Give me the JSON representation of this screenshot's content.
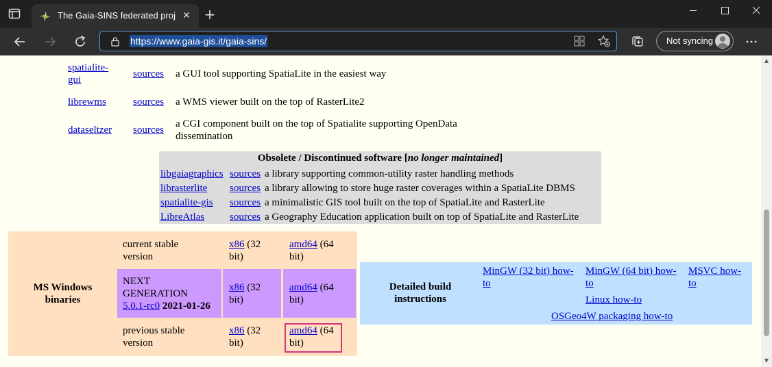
{
  "browser": {
    "tab_title": "The Gaia-SINS federated project",
    "url": "https://www.gaia-gis.it/gaia-sins/",
    "profile_label": "Not syncing",
    "icons": [
      "tab-actions-icon",
      "favicon-icon",
      "close-icon",
      "plus-icon",
      "minimize-icon",
      "maximize-icon",
      "window-close-icon",
      "back-icon",
      "forward-icon",
      "refresh-icon",
      "lock-icon",
      "apps-icon",
      "favorite-add-icon",
      "collections-icon",
      "more-icon"
    ]
  },
  "tools": [
    {
      "name": "spatialite-gui",
      "sources": "sources",
      "desc": "a GUI tool supporting SpatiaLite in the easiest way"
    },
    {
      "name": "librewms",
      "sources": "sources",
      "desc": "a WMS viewer built on the top of RasterLite2"
    },
    {
      "name": "dataseltzer",
      "sources": "sources",
      "desc": "a CGI component built on the top of Spatialite supporting OpenData dissemination"
    }
  ],
  "obsolete": {
    "title_prefix": "Obsolete / Discontinued software [",
    "title_em": "no longer maintained",
    "title_suffix": "]",
    "items": [
      {
        "name": "libgaiagraphics",
        "sources": "sources",
        "desc": "a library supporting common-utility raster handling methods"
      },
      {
        "name": "librasterlite",
        "sources": "sources",
        "desc": "a library allowing to store huge raster coverages within a SpatiaLite DBMS"
      },
      {
        "name": "spatialite-gis",
        "sources": "sources",
        "desc": "a minimalistic GIS tool built on the top of SpatiaLite and RasterLite"
      },
      {
        "name": "LibreAtlas",
        "sources": "sources",
        "desc": "a Geography Education application built on top of SpatiaLite and RasterLite"
      }
    ]
  },
  "windows": {
    "heading_line1": "MS Windows",
    "heading_line2": "binaries",
    "rows": [
      {
        "label1": "current stable",
        "label2": "version",
        "x86": "x86",
        "x86_rest1": " (32",
        "x86_rest2": "bit)",
        "amd64": "amd64",
        "amd64_rest1": " (64",
        "amd64_rest2": "bit)"
      },
      {
        "label1": "NEXT",
        "label2": "GENERATION",
        "version_link": "5.0.1-rc0",
        "date": " 2021-01-26",
        "x86": "x86",
        "x86_rest1": " (32",
        "x86_rest2": "bit)",
        "amd64": "amd64",
        "amd64_rest1": " (64",
        "amd64_rest2": "bit)"
      },
      {
        "label1": "previous stable",
        "label2": "version",
        "x86": "x86",
        "x86_rest1": " (32",
        "x86_rest2": "bit)",
        "amd64": "amd64",
        "amd64_rest1": " (64",
        "amd64_rest2": "bit)"
      }
    ]
  },
  "build": {
    "heading_line1": "Detailed build",
    "heading_line2": "instructions",
    "mingw32_l1": "MinGW (32 bit) how-",
    "mingw32_l2": "to",
    "mingw64_l1": "MinGW (64 bit) how-",
    "mingw64_l2": "to",
    "msvc_l1": "MSVC how-",
    "msvc_l2": "to",
    "linux": "Linux how-to",
    "osgeo": "OSGeo4W packaging how-to"
  },
  "colors": {
    "link": "#0000cc",
    "page_bg": "#fffff2",
    "obsolete_bg": "#dcdcdc",
    "windows_bg": "#ffe0c0",
    "next_gen_bg": "#cc99ff",
    "build_bg": "#c0e0ff",
    "highlight": "#d6337f"
  }
}
